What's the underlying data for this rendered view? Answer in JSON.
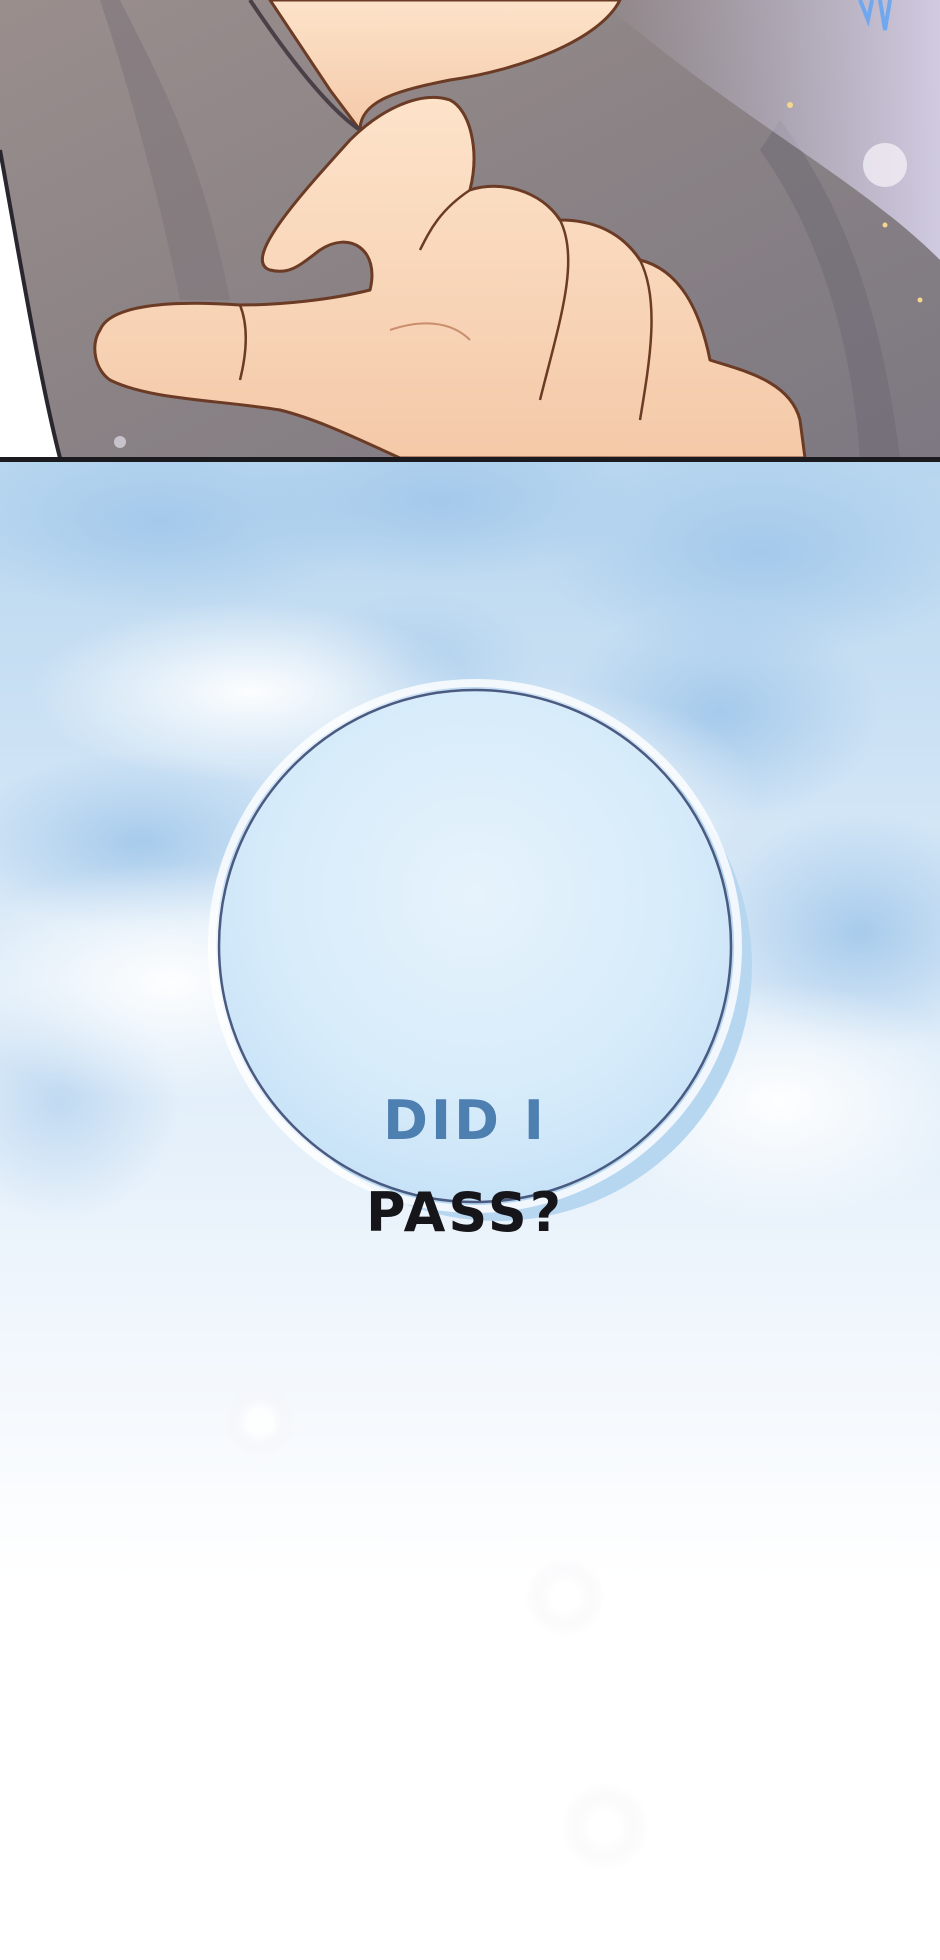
{
  "speech_bubble": {
    "line_1": "DID I",
    "line_2": "PASS?"
  },
  "colors": {
    "panel_border": "#1b1b1f",
    "sky_blue": "#a9cdea",
    "bubble_fill": "#e6f3fc",
    "bubble_shadow": "#b7d7f1",
    "bubble_outline": "#4a5a80",
    "text_blue": "#4d7fb0",
    "text_dark": "#16161a"
  }
}
